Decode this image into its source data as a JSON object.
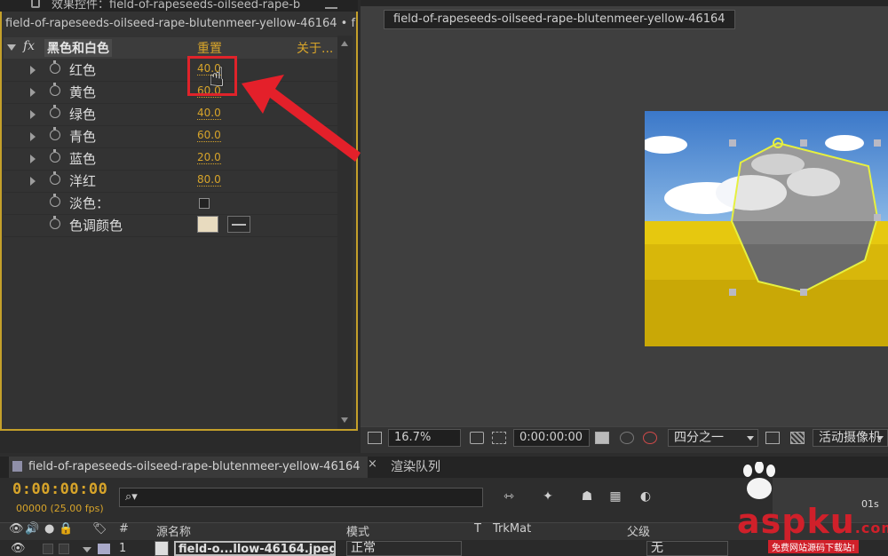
{
  "effect_panel": {
    "tab_title": "效果控件：field-of-rapeseeds-oilseed-rape-b",
    "source_line": "field-of-rapeseeds-oilseed-rape-blutenmeer-yellow-46164 • f",
    "effect_name": "黑色和白色",
    "reset_label": "重置",
    "about_label": "关于...",
    "params": [
      {
        "label": "红色",
        "value": "40.0"
      },
      {
        "label": "黄色",
        "value": "60.0"
      },
      {
        "label": "绿色",
        "value": "40.0"
      },
      {
        "label": "青色",
        "value": "60.0"
      },
      {
        "label": "蓝色",
        "value": "20.0"
      },
      {
        "label": "洋红",
        "value": "80.0"
      }
    ],
    "tint_label": "淡色：",
    "tint_color_label": "色调颜色",
    "tint_color": "#e8dbbf"
  },
  "viewer": {
    "comp_tab": "field-of-rapeseeds-oilseed-rape-blutenmeer-yellow-46164",
    "zoom": "16.7%",
    "timecode": "0:00:00:00",
    "resolution": "四分之一",
    "camera": "活动摄像机"
  },
  "timeline": {
    "tab_label": "field-of-rapeseeds-oilseed-rape-blutenmeer-yellow-46164",
    "tab_close": "×",
    "render_queue": "渲染队列",
    "timecode": "0:00:00:00",
    "fps": "00000 (25.00 fps)",
    "search_icon": "⌕▾",
    "columns": {
      "index": "#",
      "source_name": "源名称",
      "mode": "模式",
      "t": "T",
      "trkmat": "TrkMat",
      "parent": "父级"
    },
    "layer": {
      "index": "1",
      "name": "field-o...llow-46164.jpeg",
      "mode": "正常",
      "parent": "无"
    },
    "ruler_label": "01s"
  },
  "watermark": {
    "text": "aspku",
    "suffix": ".com",
    "subtitle": "免费网站源码下载站!"
  },
  "colors": {
    "accent": "#d7a42a",
    "highlight": "#e0232a",
    "panel_border": "#c4a02a"
  }
}
